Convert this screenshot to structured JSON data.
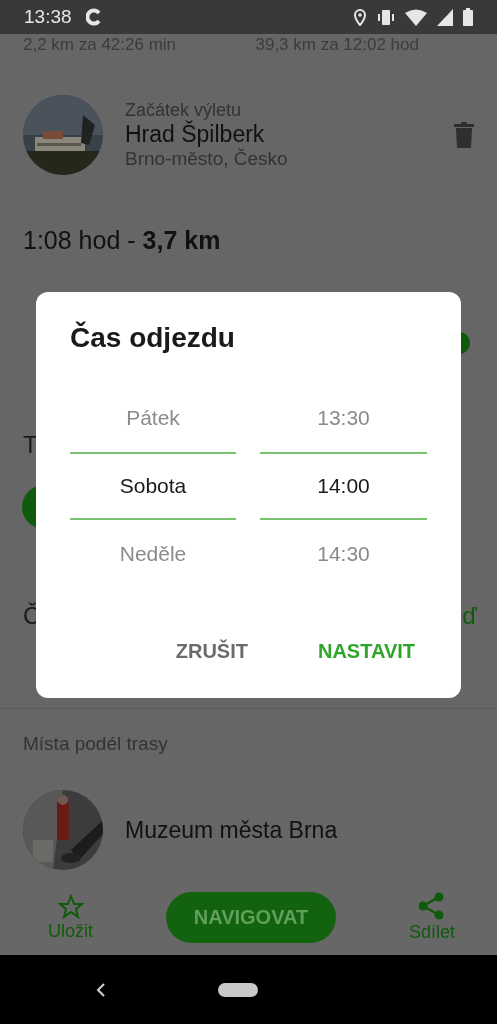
{
  "status_bar": {
    "time": "13:38"
  },
  "route_summary": {
    "left": "2,2 km za 42:26 min",
    "right": "39,3 km za 12:02 hod"
  },
  "start": {
    "label": "Začátek výletu",
    "name": "Hrad Špilberk",
    "location": "Brno-město, Česko"
  },
  "trip_total": "1:08 hod - **3,7 km**",
  "covered_rows": [
    {
      "left": "T"
    },
    {
      "left": "Č",
      "right": "ď"
    }
  ],
  "dialog": {
    "title": "Čas odjezdu",
    "day_picker": [
      {
        "label": "Pátek",
        "selected": false
      },
      {
        "label": "Sobota",
        "selected": true
      },
      {
        "label": "Neděle",
        "selected": false
      }
    ],
    "time_picker": [
      {
        "label": "13:30",
        "selected": false
      },
      {
        "label": "14:00",
        "selected": true
      },
      {
        "label": "14:30",
        "selected": false
      }
    ],
    "buttons": [
      {
        "label": "ZRUŠIT",
        "kind": "cancel"
      },
      {
        "label": "NASTAVIT",
        "kind": "confirm"
      }
    ]
  },
  "stops": {
    "heading": "Místa podél trasy",
    "items": [
      {
        "name": "Muzeum města Brna"
      }
    ]
  },
  "bottom_bar": {
    "save": "Uložit",
    "navigate": "NAVIGOVAT",
    "share": "Sdílet"
  }
}
